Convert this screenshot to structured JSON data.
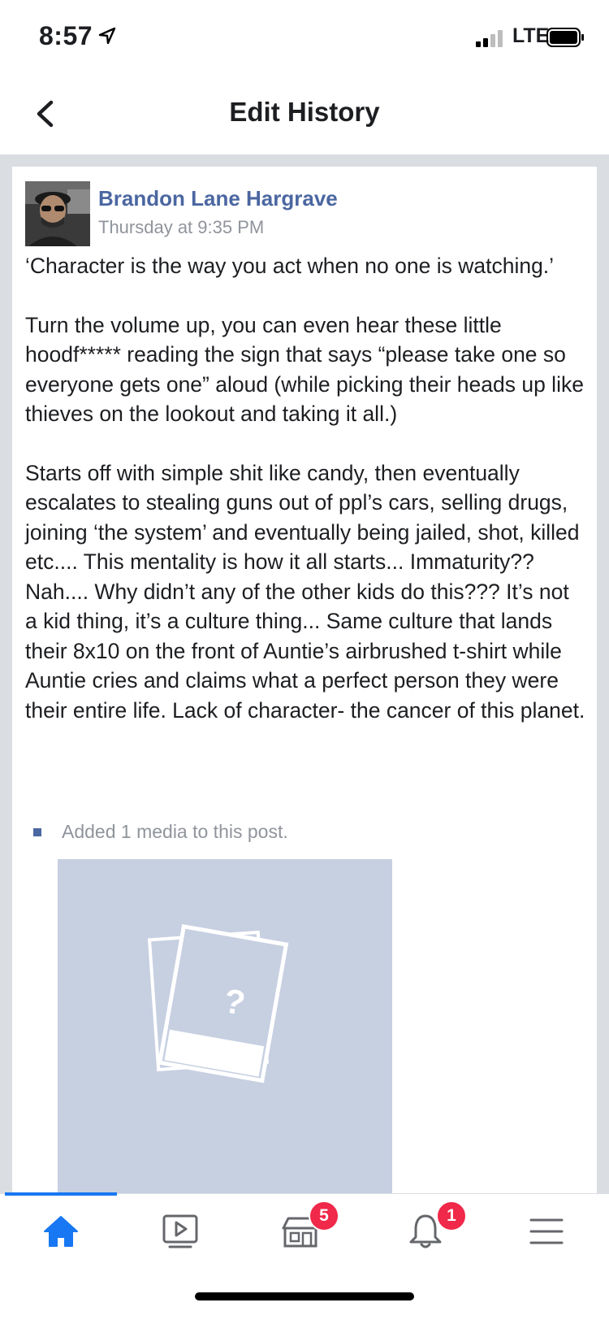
{
  "status_bar": {
    "time": "8:57",
    "network": "LTE"
  },
  "header": {
    "title": "Edit History"
  },
  "post": {
    "author": "Brandon Lane Hargrave",
    "timestamp": "Thursday at 9:35 PM",
    "paragraphs": [
      "‘Character is the way you act when no one is watching.’",
      "Turn the volume up, you can even hear these little hoodf***** reading the sign that says “please take one so everyone gets one” aloud (while picking their heads up like thieves on the lookout and taking it all.)",
      "Starts off with simple shit like candy, then eventually escalates to stealing guns out of ppl’s cars, selling drugs, joining ‘the system’ and eventually being jailed, shot, killed etc.... This mentality is how it all starts... Immaturity?? Nah.... Why didn’t any of the other kids do this??? It’s not a kid thing, it’s a culture thing... Same culture that lands their 8x10 on the front of Auntie’s airbrushed t-shirt while Auntie cries and claims what a perfect person they were their entire life. Lack of character- the cancer of this planet."
    ],
    "media_note": "Added 1 media to this post.",
    "media_placeholder_glyph": "?"
  },
  "tab_bar": {
    "tabs": [
      {
        "icon": "home-icon",
        "active": true
      },
      {
        "icon": "video-icon",
        "active": false
      },
      {
        "icon": "marketplace-icon",
        "active": false,
        "badge": "5"
      },
      {
        "icon": "bell-icon",
        "active": false,
        "badge": "1"
      },
      {
        "icon": "menu-icon",
        "active": false
      }
    ]
  },
  "colors": {
    "accent": "#1877f2",
    "author_link": "#4b67a1",
    "badge": "#f02849",
    "feed_background": "#dadde1",
    "media_placeholder": "#c7d0e1"
  }
}
